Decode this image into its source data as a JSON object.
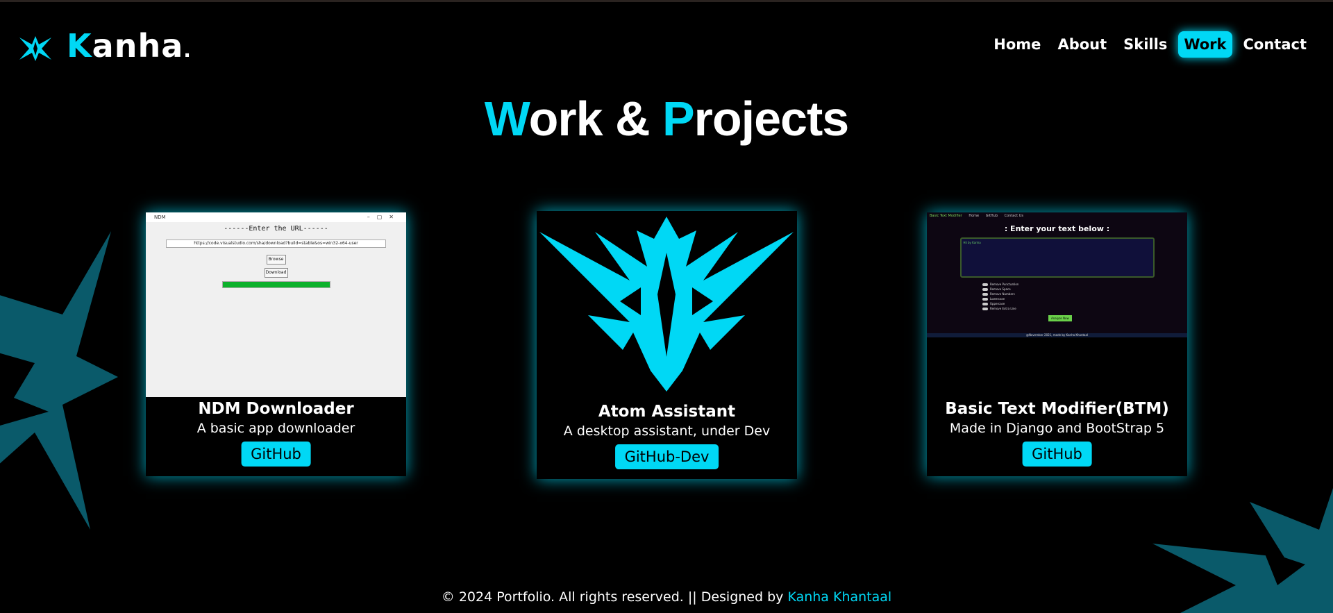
{
  "header": {
    "logo_letter": "K",
    "logo_rest": "anha",
    "logo_dot": ".",
    "nav": [
      "Home",
      "About",
      "Skills",
      "Work",
      "Contact"
    ],
    "active_nav": "Work"
  },
  "page_title": {
    "first_letter": "W",
    "first_rest": "ork &",
    "second_letter": "P",
    "second_rest": "rojects"
  },
  "cards": [
    {
      "title": "NDM Downloader",
      "desc": "A basic app downloader",
      "button": "GitHub",
      "thumb": {
        "window_title": "NDM",
        "label": "------Enter the URL------",
        "url": "https://code.visualstudio.com/sha/download?build=stable&os=win32-x64-user",
        "browse": "Browse",
        "download": "Download",
        "progress": 1.0
      }
    },
    {
      "title": "Atom Assistant",
      "desc": "A desktop assistant, under Dev",
      "button": "GitHub-Dev"
    },
    {
      "title": "Basic Text Modifier(BTM)",
      "desc": "Made in Django and BootStrap 5",
      "button": "GitHub",
      "thumb": {
        "brand": "Basic Text Modifier",
        "nav": [
          "Home",
          "GitHub",
          "Contact Us"
        ],
        "heading": ": Enter your text below :",
        "placeholder": "Hii by Kanha",
        "options": [
          "Remove Punctuation",
          "Remove Space",
          "Remove Numbers",
          "Lowercase",
          "Uppercase",
          "Remove Extra Line"
        ],
        "button": "Analyze Now",
        "footer": "@November 2021, made by Kanha Khantaal"
      }
    }
  ],
  "footer": {
    "text": "© 2024 Portfolio. All rights reserved. || Designed by",
    "link": "Kanha Khantaal"
  },
  "colors": {
    "accent": "#00d8f5",
    "background": "#000000",
    "progress": "#0cb12b"
  },
  "icons": [
    "atom-logo-icon"
  ]
}
